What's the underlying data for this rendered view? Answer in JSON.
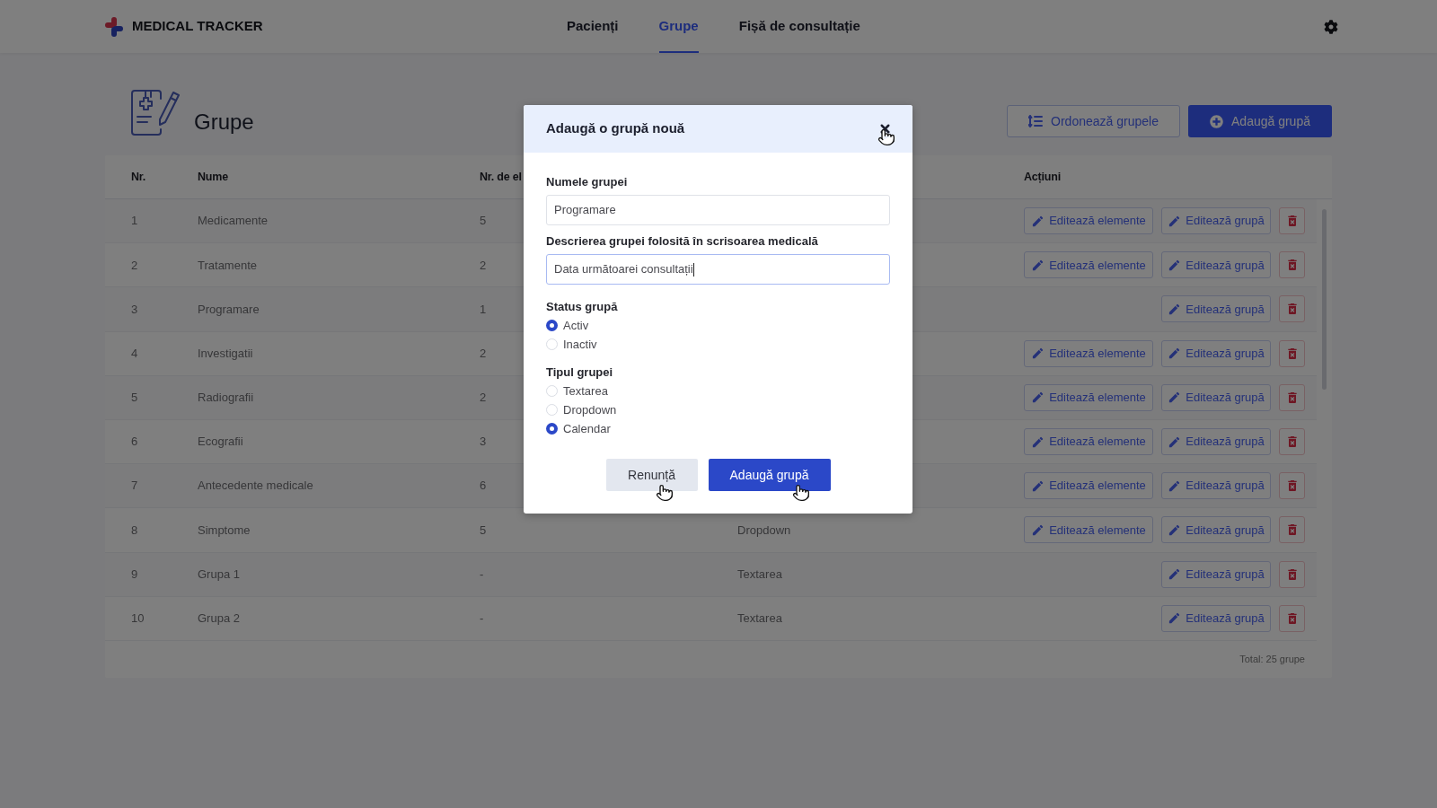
{
  "header": {
    "logo": "MEDICAL TRACKER",
    "nav": [
      {
        "label": "Pacienți",
        "selected": false
      },
      {
        "label": "Grupe",
        "selected": true
      },
      {
        "label": "Fișă de consultație",
        "selected": false
      }
    ]
  },
  "page": {
    "title": "Grupe",
    "buttons": [
      {
        "label": "Ordonează grupele",
        "kind": "outline"
      },
      {
        "label": "Adaugă grupă",
        "kind": "primary"
      }
    ]
  },
  "table": {
    "header": {
      "nr": "Nr.",
      "name": "Nume",
      "column_3": "Nr. de el",
      "actions": "Acțiuni"
    },
    "rows": [
      {
        "nr": "1",
        "name": "Medicamente",
        "column_3": "5",
        "actions": [
          {
            "kind": "edit_elements",
            "label": "Editează elemente"
          },
          {
            "kind": "edit_group",
            "label": "Editează grupă"
          },
          {
            "kind": "delete"
          }
        ]
      },
      {
        "nr": "2",
        "name": "Tratamente",
        "column_3": "2",
        "actions": [
          {
            "kind": "edit_elements",
            "label": "Editează elemente"
          },
          {
            "kind": "edit_group",
            "label": "Editează grupă"
          },
          {
            "kind": "delete"
          }
        ]
      },
      {
        "nr": "3",
        "name": "Programare",
        "column_3": "1",
        "actions": [
          {
            "kind": "edit_group",
            "label": "Editează grupă"
          },
          {
            "kind": "delete"
          }
        ]
      },
      {
        "nr": "4",
        "name": "Investigatii",
        "column_3": "2",
        "actions": [
          {
            "kind": "edit_elements",
            "label": "Editează elemente"
          },
          {
            "kind": "edit_group",
            "label": "Editează grupă"
          },
          {
            "kind": "delete"
          }
        ]
      },
      {
        "nr": "5",
        "name": "Radiografii",
        "column_3": "2",
        "actions": [
          {
            "kind": "edit_elements",
            "label": "Editează elemente"
          },
          {
            "kind": "edit_group",
            "label": "Editează grupă"
          },
          {
            "kind": "delete"
          }
        ]
      },
      {
        "nr": "6",
        "name": "Ecografii",
        "column_3": "3",
        "actions": [
          {
            "kind": "edit_elements",
            "label": "Editează elemente"
          },
          {
            "kind": "edit_group",
            "label": "Editează grupă"
          },
          {
            "kind": "delete"
          }
        ]
      },
      {
        "nr": "7",
        "name": "Antecedente medicale",
        "column_3": "6",
        "actions": [
          {
            "kind": "edit_elements",
            "label": "Editează elemente"
          },
          {
            "kind": "edit_group",
            "label": "Editează grupă"
          },
          {
            "kind": "delete"
          }
        ]
      },
      {
        "nr": "8",
        "name": "Simptome",
        "column_3": "5",
        "column_4": "Dropdown",
        "actions": [
          {
            "kind": "edit_elements",
            "label": "Editează elemente"
          },
          {
            "kind": "edit_group",
            "label": "Editează grupă"
          },
          {
            "kind": "delete"
          }
        ]
      },
      {
        "nr": "9",
        "name": "Grupa 1",
        "column_3": "-",
        "column_4": "Textarea",
        "actions": [
          {
            "kind": "edit_group",
            "label": "Editează grupă"
          },
          {
            "kind": "delete"
          }
        ]
      },
      {
        "nr": "10",
        "name": "Grupa 2",
        "column_3": "-",
        "column_4": "Textarea",
        "actions": [
          {
            "kind": "edit_group",
            "label": "Editează grupă"
          },
          {
            "kind": "delete"
          }
        ]
      }
    ],
    "total": "Total: 25 grupe"
  },
  "modal": {
    "title": "Adaugă o grupă nouă",
    "fields": [
      {
        "label": "Numele grupei",
        "value": "Programare",
        "focused": false
      },
      {
        "label": "Descrierea grupei folosită în scrisoarea medicală",
        "value": "Data următoarei consultații",
        "focused": true
      }
    ],
    "radio_groups": [
      {
        "label": "Status grupă",
        "options": [
          {
            "label": "Activ",
            "selected": true
          },
          {
            "label": "Inactiv",
            "selected": false
          }
        ]
      },
      {
        "label": "Tipul grupei",
        "options": [
          {
            "label": "Textarea",
            "selected": false
          },
          {
            "label": "Dropdown",
            "selected": false
          },
          {
            "label": "Calendar",
            "selected": true
          }
        ]
      }
    ],
    "buttons": [
      {
        "label": "Renunță",
        "kind": "secondary"
      },
      {
        "label": "Adaugă grupă",
        "kind": "primary"
      }
    ]
  }
}
